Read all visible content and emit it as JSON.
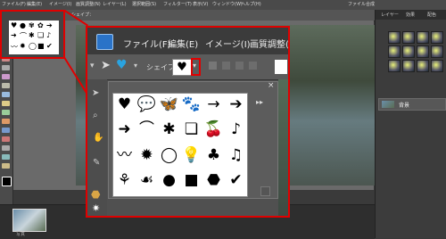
{
  "menubar": {
    "items": [
      "ファイル(F)",
      "編集(E)",
      "イメージ(I)",
      "画質調整(N)",
      "レイヤー(L)",
      "選択範囲(S)",
      "フィルター(T)",
      "表示(V)",
      "ウィンドウ(W)",
      "ヘルプ(H)"
    ],
    "right_label": "ファイル合成"
  },
  "options_bar": {
    "shape_label": "シェイプ："
  },
  "zoom_menu": {
    "file": "ファイル(F)",
    "edit": "編集(E)",
    "image": "イメージ(I)",
    "adjust": "画質調整(N"
  },
  "zoom_options": {
    "shape_label": "シェイプ："
  },
  "picker": {
    "close": "×",
    "menu": "▸▸",
    "shapes": [
      "♥",
      "💬",
      "🦋",
      "🐾",
      "→",
      "➔",
      "➜",
      "⌒",
      "✱",
      "❏",
      "🍒",
      "♪",
      "〰",
      "✹",
      "◯",
      "💡",
      "♣",
      "♫",
      "⚘",
      "☙",
      "●",
      "■",
      "⬣",
      "✔"
    ]
  },
  "right_panel": {
    "tabs": [
      "レイヤー",
      "効果",
      "配色"
    ],
    "layer_name": "背景"
  },
  "bottom": {
    "thumb_label": "写真"
  },
  "colors": {
    "accent_red": "#e00000",
    "panel": "#3c3c3c",
    "logo_blue": "#2a73c8"
  }
}
